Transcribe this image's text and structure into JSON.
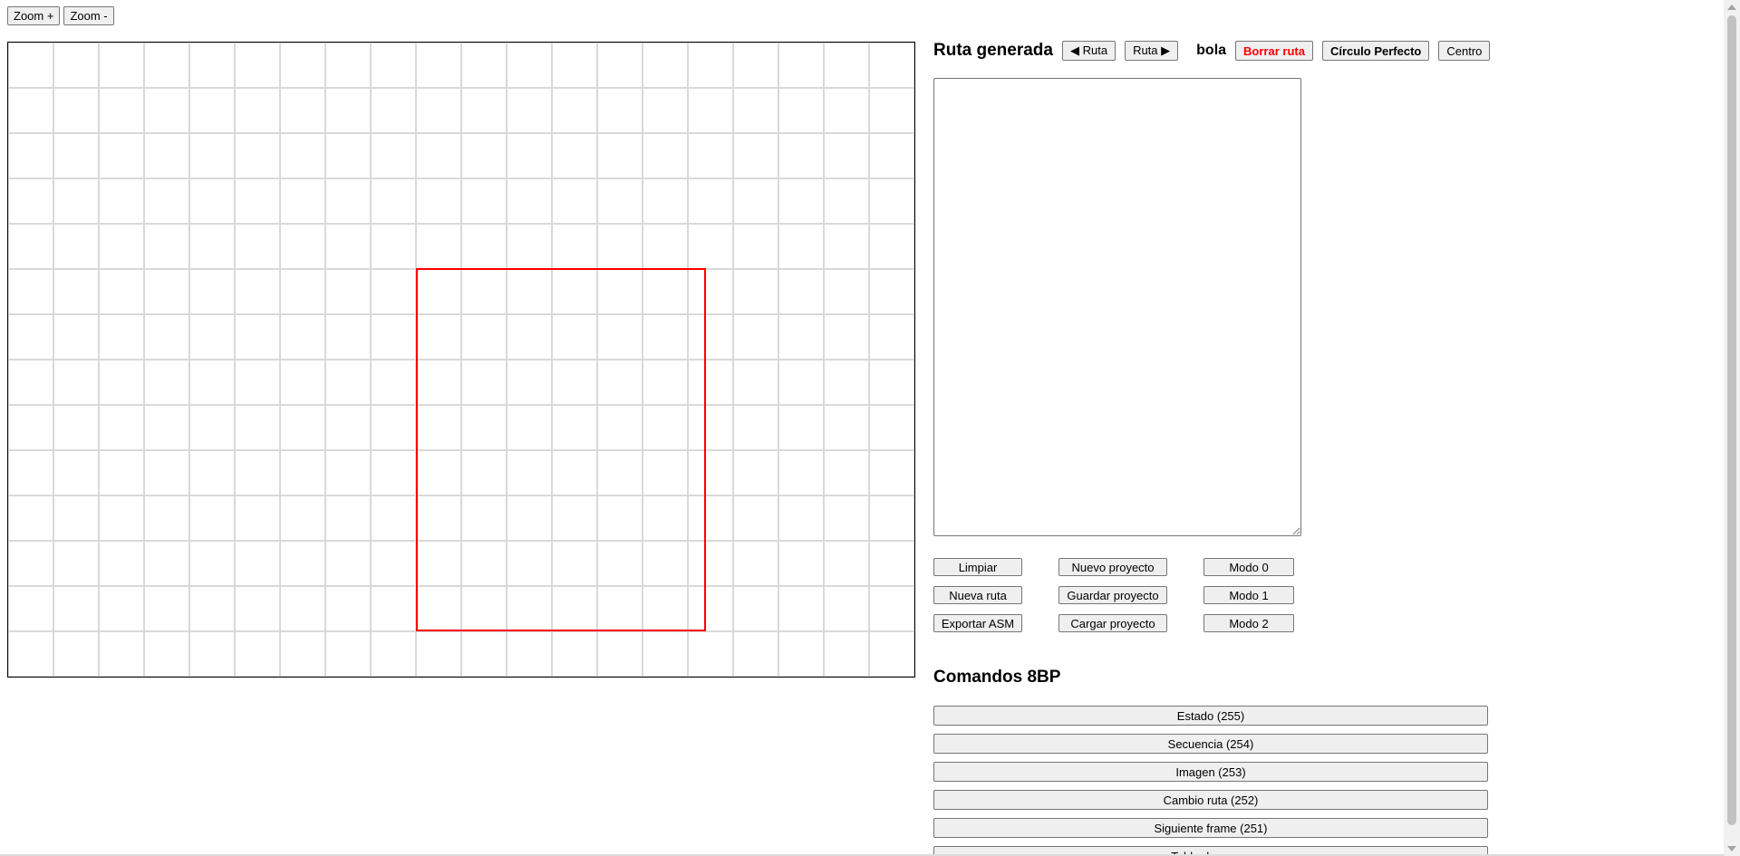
{
  "toolbar": {
    "zoom_in_label": "Zoom +",
    "zoom_out_label": "Zoom -"
  },
  "canvas": {
    "grid_color": "#d9d9d9",
    "route_color": "#ff0000"
  },
  "header": {
    "title": "Ruta generada",
    "prev_route_label": "◀ Ruta",
    "next_route_label": "Ruta ▶",
    "entity_name": "bola",
    "delete_route_label": "Borrar ruta",
    "perfect_circle_label": "Círculo Perfecto",
    "center_label": "Centro"
  },
  "route_text": {
    "value": ""
  },
  "actions": {
    "clear_label": "Limpiar",
    "new_route_label": "Nueva ruta",
    "export_asm_label": "Exportar ASM",
    "new_project_label": "Nuevo proyecto",
    "save_project_label": "Guardar proyecto",
    "load_project_label": "Cargar proyecto",
    "mode0_label": "Modo 0",
    "mode1_label": "Modo 1",
    "mode2_label": "Modo 2"
  },
  "commands": {
    "title": "Comandos 8BP",
    "items": [
      {
        "label": "Estado (255)"
      },
      {
        "label": "Secuencia (254)"
      },
      {
        "label": "Imagen (253)"
      },
      {
        "label": "Cambio ruta (252)"
      },
      {
        "label": "Siguiente frame (251)"
      },
      {
        "label": "Tabla de pasos"
      }
    ]
  }
}
